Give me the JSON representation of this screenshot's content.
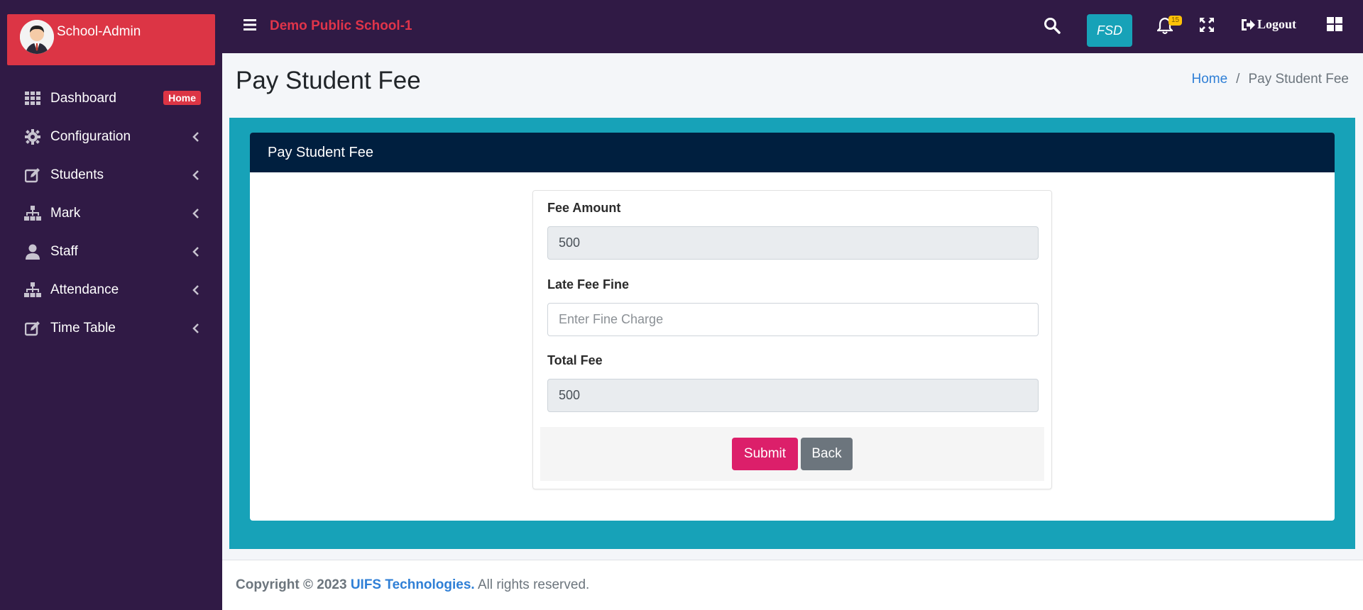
{
  "sidebar": {
    "brand": "School-Admin",
    "items": [
      {
        "label": "Dashboard",
        "icon": "dashboard-grid-icon",
        "badge": "Home"
      },
      {
        "label": "Configuration",
        "icon": "gear-icon"
      },
      {
        "label": "Students",
        "icon": "edit-icon"
      },
      {
        "label": "Mark",
        "icon": "sitemap-icon"
      },
      {
        "label": "Staff",
        "icon": "user-icon"
      },
      {
        "label": "Attendance",
        "icon": "sitemap-icon"
      },
      {
        "label": "Time Table",
        "icon": "edit-icon"
      }
    ]
  },
  "topbar": {
    "school_name": "Demo Public School-1",
    "fsd_label": "FSD",
    "notification_count": "15",
    "logout_label": "Logout"
  },
  "page": {
    "title": "Pay Student Fee",
    "breadcrumb": {
      "home": "Home",
      "separator": "/",
      "current": "Pay Student Fee"
    }
  },
  "card": {
    "header": "Pay Student Fee",
    "fields": {
      "fee_amount": {
        "label": "Fee Amount",
        "value": "500"
      },
      "late_fee": {
        "label": "Late Fee Fine",
        "placeholder": "Enter Fine Charge"
      },
      "total_fee": {
        "label": "Total Fee",
        "value": "500"
      }
    },
    "submit_label": "Submit",
    "back_label": "Back"
  },
  "footer": {
    "prefix": "Copyright © 2023",
    "company": "UIFS Technologies.",
    "suffix": "All rights reserved."
  },
  "colors": {
    "sidebar_bg": "#301a45",
    "brand_red": "#dc3545",
    "teal": "#17a2b8",
    "card_header": "#001f3f",
    "submit": "#dc1f6a",
    "back": "#6c757d"
  }
}
